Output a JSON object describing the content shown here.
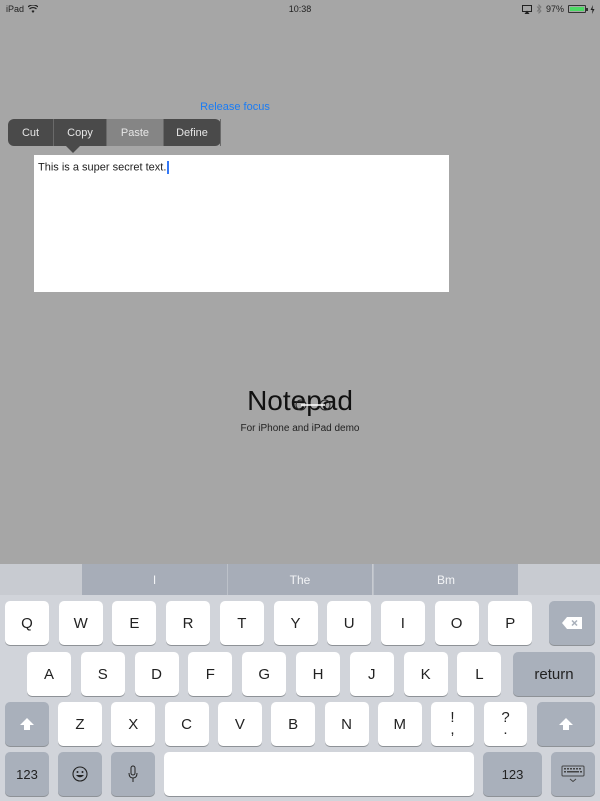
{
  "status_bar": {
    "device": "iPad",
    "time": "10:38",
    "battery_percent": "97%",
    "battery_level": 0.97,
    "icons": [
      "wifi-icon",
      "airplay-icon",
      "bluetooth-icon",
      "battery-icon",
      "charging-icon"
    ]
  },
  "release_focus_label": "Release focus",
  "edit_menu": {
    "items": [
      "Cut",
      "Copy",
      "Paste",
      "Define"
    ],
    "highlighted": "Paste"
  },
  "textarea": {
    "value": "This is a super secret text."
  },
  "brand": {
    "title": "Notepad",
    "subtitle": "For iPhone and iPad demo"
  },
  "keyboard": {
    "suggestions": [
      "I",
      "The",
      "Bm"
    ],
    "row1": [
      "Q",
      "W",
      "E",
      "R",
      "T",
      "Y",
      "U",
      "I",
      "O",
      "P"
    ],
    "row2": [
      "A",
      "S",
      "D",
      "F",
      "G",
      "H",
      "J",
      "K",
      "L"
    ],
    "row3": [
      "Z",
      "X",
      "C",
      "V",
      "B",
      "N",
      "M"
    ],
    "punct1": {
      "top": "!",
      "bottom": ","
    },
    "punct2": {
      "top": "?",
      "bottom": "."
    },
    "return_label": "return",
    "numbers_label": "123",
    "space_label": ""
  }
}
